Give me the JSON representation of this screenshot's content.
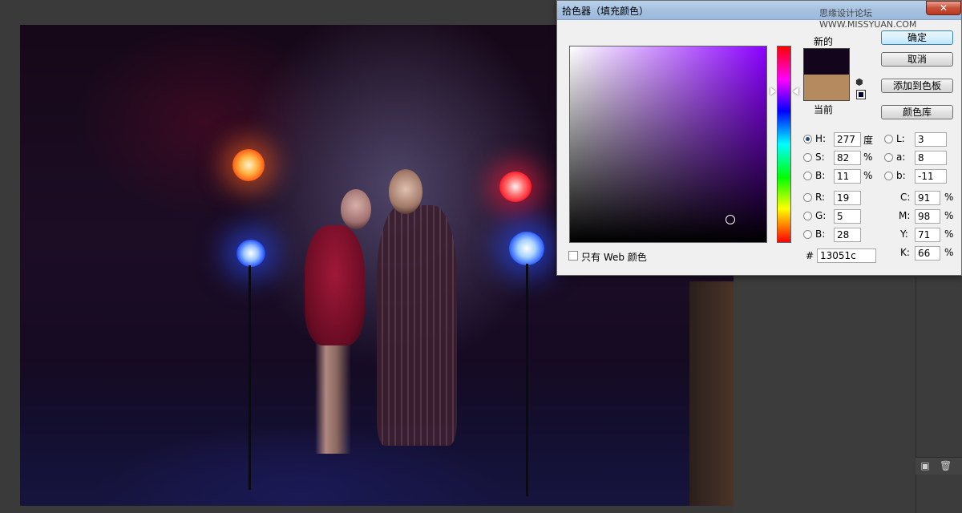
{
  "dialog": {
    "title": "拾色器（填充颜色）",
    "watermark": "思缘设计论坛 WWW.MISSYUAN.COM",
    "close_glyph": "✕",
    "label_new": "新的",
    "label_current": "当前",
    "buttons": {
      "ok": "确定",
      "cancel": "取消",
      "add_to_swatches": "添加到色板",
      "color_libraries": "颜色库"
    },
    "hsb": {
      "h_label": "H:",
      "h_value": "277",
      "h_unit": "度",
      "s_label": "S:",
      "s_value": "82",
      "s_unit": "%",
      "b_label": "B:",
      "b_value": "11",
      "b_unit": "%"
    },
    "lab": {
      "l_label": "L:",
      "l_value": "3",
      "a_label": "a:",
      "a_value": "8",
      "b_label": "b:",
      "b_value": "-11"
    },
    "rgb": {
      "r_label": "R:",
      "r_value": "19",
      "g_label": "G:",
      "g_value": "5",
      "b_label": "B:",
      "b_value": "28"
    },
    "cmyk": {
      "c_label": "C:",
      "c_value": "91",
      "m_label": "M:",
      "m_value": "98",
      "y_label": "Y:",
      "y_value": "71",
      "k_label": "K:",
      "k_value": "66",
      "unit": "%"
    },
    "hex_label": "#",
    "hex_value": "13051c",
    "websafe_label": "只有 Web 颜色",
    "colors": {
      "new_color": "#13051c",
      "current_color": "#b48a5e",
      "hue_color": "#8a00ff"
    },
    "icons": {
      "cube": "⬢"
    }
  },
  "panel": {
    "camera_glyph": "▣",
    "trash_glyph": "🗑"
  }
}
